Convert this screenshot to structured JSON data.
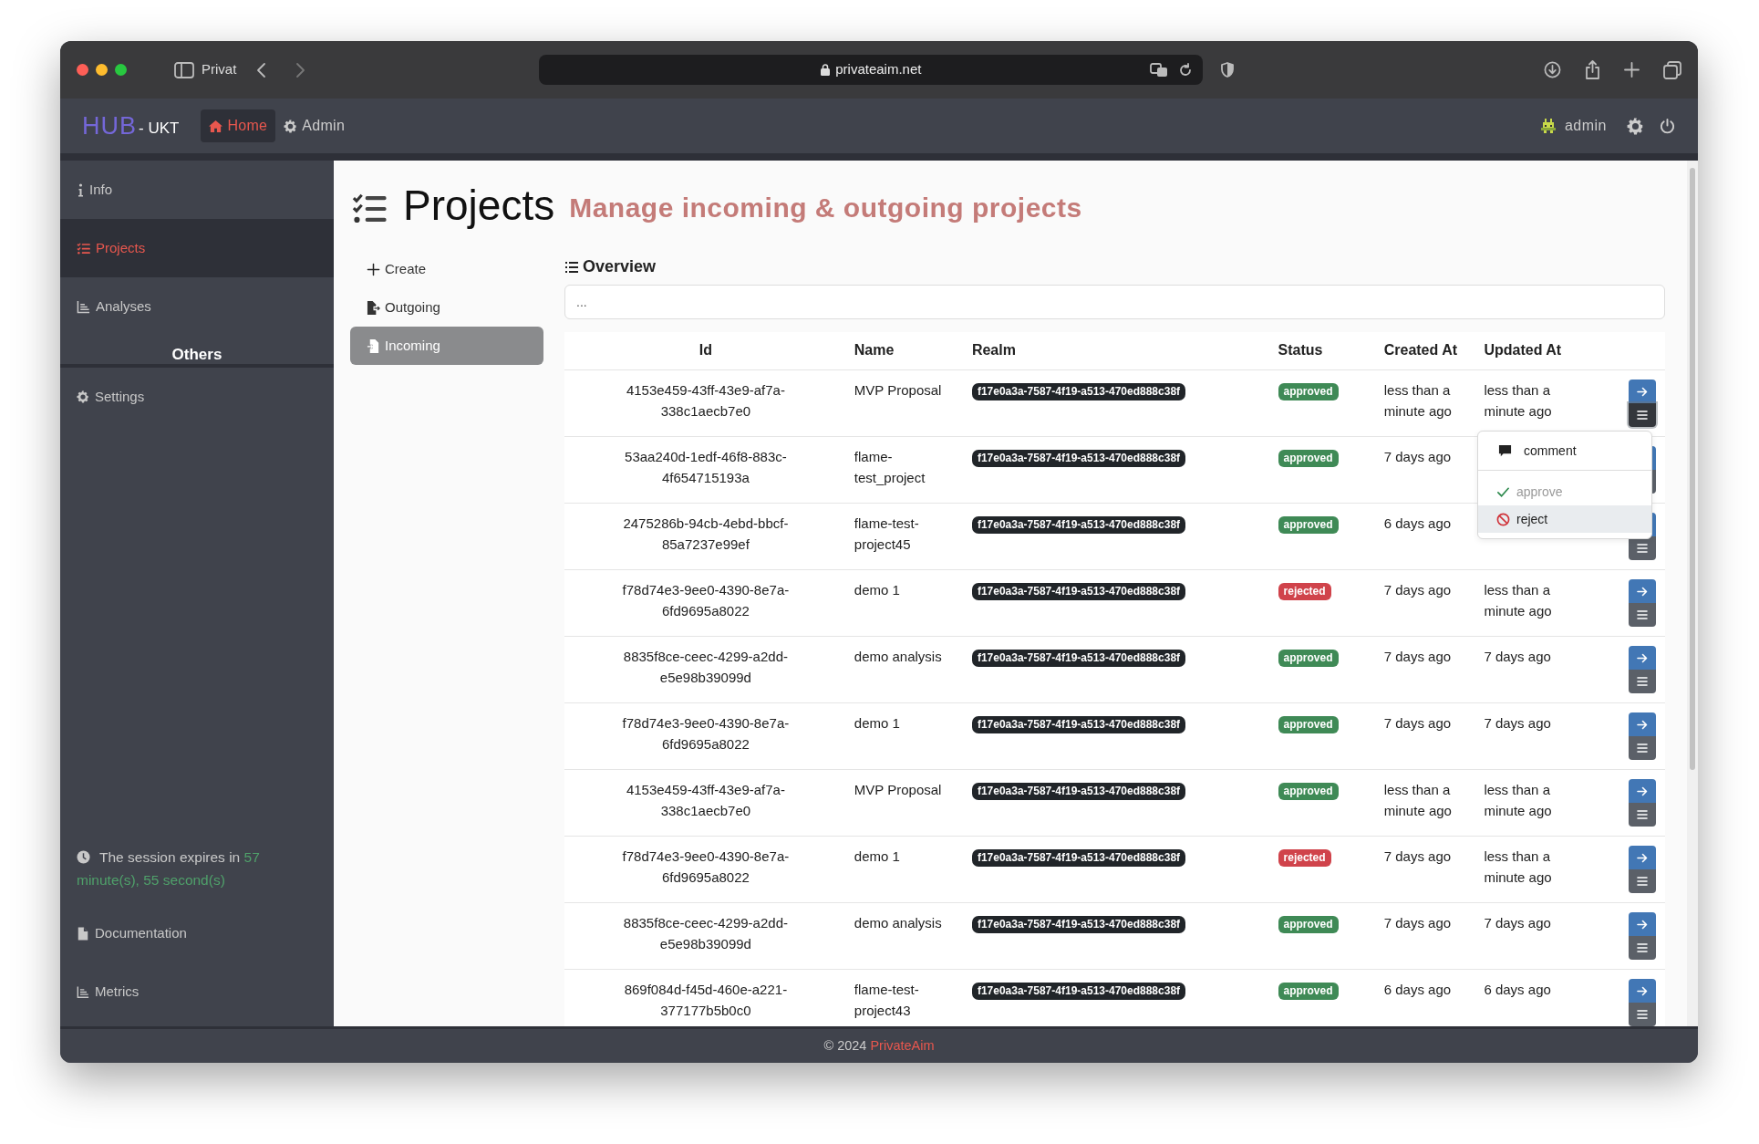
{
  "browser": {
    "profile": "Privat",
    "address": "privateaim.net"
  },
  "navbar": {
    "brand": "HUB",
    "brand_suffix": "- UKT",
    "items": [
      {
        "label": "Home",
        "selected": true
      },
      {
        "label": "Admin",
        "selected": false
      }
    ],
    "user": "admin"
  },
  "sidebar": {
    "items": [
      {
        "label": "Info",
        "selected": false
      },
      {
        "label": "Projects",
        "selected": true
      },
      {
        "label": "Analyses",
        "selected": false
      }
    ],
    "section_heading": "Others",
    "section_items": [
      {
        "label": "Settings",
        "selected": false
      }
    ],
    "session": {
      "text": "The session expires in",
      "remaining": "57 minute(s), 55 second(s)"
    },
    "bottom_links": [
      "Documentation",
      "Metrics"
    ]
  },
  "page": {
    "title": "Projects",
    "subtitle": "Manage incoming & outgoing projects"
  },
  "subnav": [
    {
      "label": "Create",
      "selected": false
    },
    {
      "label": "Outgoing",
      "selected": false
    },
    {
      "label": "Incoming",
      "selected": true
    }
  ],
  "overview": {
    "heading": "Overview",
    "search": {
      "placeholder": "..."
    }
  },
  "table": {
    "columns": [
      "Id",
      "Name",
      "Realm",
      "Status",
      "Created At",
      "Updated At"
    ],
    "rows": [
      {
        "id": "4153e459-43ff-43e9-af7a-338c1aecb7e0",
        "name": "MVP Proposal",
        "realm": "f17e0a3a-7587-4f19-a513-470ed888c38f",
        "status": {
          "label": "approved",
          "color": "#3f8a56"
        },
        "created": "less than a minute ago",
        "updated": "less than a minute ago",
        "menu_open": true
      },
      {
        "id": "53aa240d-1edf-46f8-883c-4f654715193a",
        "name": "flame-test_project",
        "realm": "f17e0a3a-7587-4f19-a513-470ed888c38f",
        "status": {
          "label": "approved",
          "color": "#3f8a56"
        },
        "created": "7 days ago",
        "menu_open": false
      },
      {
        "id": "2475286b-94cb-4ebd-bbcf-85a7237e99ef",
        "name": "flame-test-project45",
        "realm": "f17e0a3a-7587-4f19-a513-470ed888c38f",
        "status": {
          "label": "approved",
          "color": "#3f8a56"
        },
        "created": "6 days ago",
        "menu_open": false
      },
      {
        "id": "f78d74e3-9ee0-4390-8e7a-6fd9695a8022",
        "name": "demo 1",
        "realm": "f17e0a3a-7587-4f19-a513-470ed888c38f",
        "status": {
          "label": "rejected",
          "color": "#d0434b"
        },
        "created": "7 days ago",
        "updated": "less than a minute ago",
        "menu_open": false
      },
      {
        "id": "8835f8ce-ceec-4299-a2dd-e5e98b39099d",
        "name": "demo analysis",
        "realm": "f17e0a3a-7587-4f19-a513-470ed888c38f",
        "status": {
          "label": "approved",
          "color": "#3f8a56"
        },
        "created": "7 days ago",
        "updated": "7 days ago",
        "menu_open": false
      },
      {
        "id": "f78d74e3-9ee0-4390-8e7a-6fd9695a8022",
        "name": "demo 1",
        "realm": "f17e0a3a-7587-4f19-a513-470ed888c38f",
        "status": {
          "label": "approved",
          "color": "#3f8a56"
        },
        "created": "7 days ago",
        "updated": "7 days ago",
        "menu_open": false
      },
      {
        "id": "4153e459-43ff-43e9-af7a-338c1aecb7e0",
        "name": "MVP Proposal",
        "realm": "f17e0a3a-7587-4f19-a513-470ed888c38f",
        "status": {
          "label": "approved",
          "color": "#3f8a56"
        },
        "created": "less than a minute ago",
        "updated": "less than a minute ago",
        "menu_open": false
      },
      {
        "id": "f78d74e3-9ee0-4390-8e7a-6fd9695a8022",
        "name": "demo 1",
        "realm": "f17e0a3a-7587-4f19-a513-470ed888c38f",
        "status": {
          "label": "rejected",
          "color": "#d0434b"
        },
        "created": "7 days ago",
        "updated": "less than a minute ago",
        "menu_open": false
      },
      {
        "id": "8835f8ce-ceec-4299-a2dd-e5e98b39099d",
        "name": "demo analysis",
        "realm": "f17e0a3a-7587-4f19-a513-470ed888c38f",
        "status": {
          "label": "approved",
          "color": "#3f8a56"
        },
        "created": "7 days ago",
        "updated": "7 days ago",
        "menu_open": false
      },
      {
        "id": "869f084d-f45d-460e-a221-377177b5b0c0",
        "name": "flame-test-project43",
        "realm": "f17e0a3a-7587-4f19-a513-470ed888c38f",
        "status": {
          "label": "approved",
          "color": "#3f8a56"
        },
        "created": "6 days ago",
        "updated": "6 days ago",
        "menu_open": false
      }
    ],
    "row_menu": [
      {
        "label": "comment",
        "disabled": false,
        "highlighted": false,
        "divider_before": false
      },
      {
        "label": "approve",
        "disabled": true,
        "highlighted": false,
        "divider_before": true
      },
      {
        "label": "reject",
        "disabled": false,
        "highlighted": true,
        "divider_before": false
      }
    ]
  },
  "footer": {
    "copyright": "© 2024",
    "link": "PrivateAim"
  }
}
